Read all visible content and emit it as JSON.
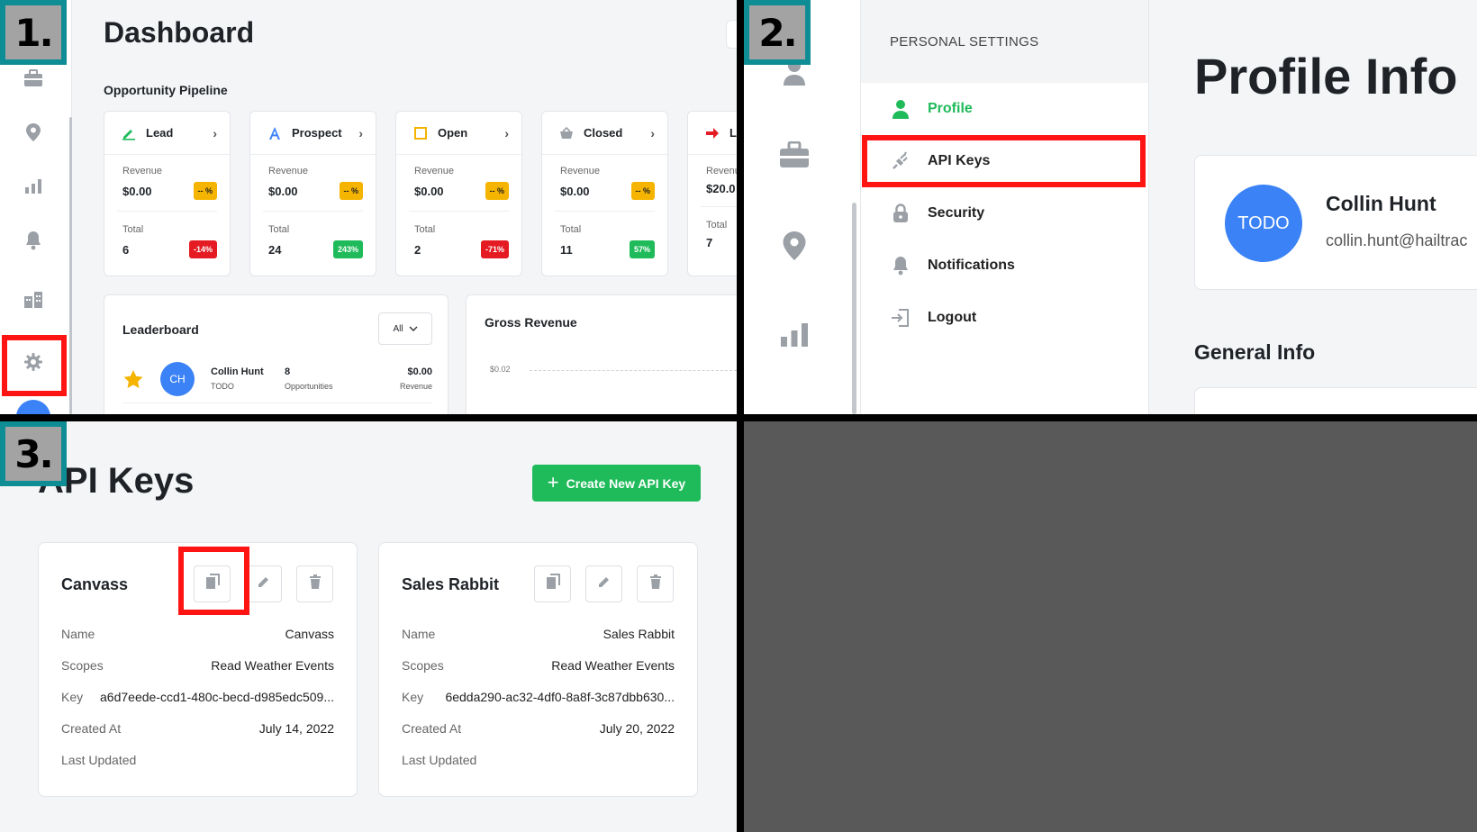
{
  "steps": [
    "1.",
    "2.",
    "3."
  ],
  "colors": {
    "accent_green": "#1fbb5a",
    "avatar_blue": "#3b82f6",
    "highlight_red": "#ff1414",
    "step_teal": "#0e8e94"
  },
  "dashboard": {
    "title": "Dashboard",
    "sidebar_icons": [
      "briefcase-icon",
      "map-pin-icon",
      "bar-chart-icon",
      "bell-icon",
      "buildings-icon",
      "gear-icon"
    ],
    "pipeline_title": "Opportunity Pipeline",
    "stages": [
      {
        "name": "Lead",
        "icon": "pencil-icon",
        "revenue_label": "Revenue",
        "revenue": "$0.00",
        "revenue_badge": "-- %",
        "total_label": "Total",
        "total": "6",
        "total_badge": "-14%",
        "total_badge_color": "red"
      },
      {
        "name": "Prospect",
        "icon": "letter-a-icon",
        "revenue_label": "Revenue",
        "revenue": "$0.00",
        "revenue_badge": "-- %",
        "total_label": "Total",
        "total": "24",
        "total_badge": "243%",
        "total_badge_color": "green"
      },
      {
        "name": "Open",
        "icon": "square-icon",
        "revenue_label": "Revenue",
        "revenue": "$0.00",
        "revenue_badge": "-- %",
        "total_label": "Total",
        "total": "2",
        "total_badge": "-71%",
        "total_badge_color": "red"
      },
      {
        "name": "Closed",
        "icon": "basket-icon",
        "revenue_label": "Revenue",
        "revenue": "$0.00",
        "revenue_badge": "-- %",
        "total_label": "Total",
        "total": "11",
        "total_badge": "57%",
        "total_badge_color": "green"
      },
      {
        "name": "L",
        "icon": "arrow-right-icon",
        "revenue_label": "Revenu",
        "revenue": "$20.0",
        "revenue_badge": "",
        "total_label": "Total",
        "total": "7",
        "total_badge": "",
        "total_badge_color": ""
      }
    ],
    "leaderboard": {
      "title": "Leaderboard",
      "filter": "All",
      "row": {
        "initials": "CH",
        "name": "Collin Hunt",
        "sub": "TODO",
        "count": "8",
        "count_label": "Opportunities",
        "revenue": "$0.00",
        "revenue_label": "Revenue"
      }
    },
    "gross_revenue": {
      "title": "Gross Revenue",
      "tick": "$0.02"
    }
  },
  "settings": {
    "sidebar_icons": [
      "person-icon",
      "briefcase-icon",
      "map-pin-icon",
      "bar-chart-icon"
    ],
    "heading": "PERSONAL SETTINGS",
    "menu": [
      {
        "label": "Profile",
        "icon": "person-icon",
        "active": true
      },
      {
        "label": "API Keys",
        "icon": "plug-icon",
        "active": false
      },
      {
        "label": "Security",
        "icon": "lock-icon",
        "active": false
      },
      {
        "label": "Notifications",
        "icon": "bell-icon",
        "active": false
      },
      {
        "label": "Logout",
        "icon": "logout-icon",
        "active": false
      }
    ],
    "profile_title": "Profile Info",
    "avatar_text": "TODO",
    "name": "Collin Hunt",
    "email": "collin.hunt@hailtrac",
    "general_title": "General Info"
  },
  "api_keys": {
    "title": "API Keys",
    "create_label": "Create New API Key",
    "keys": [
      {
        "title": "Canvass",
        "name_label": "Name",
        "name": "Canvass",
        "scopes_label": "Scopes",
        "scopes": "Read Weather Events",
        "key_label": "Key",
        "key": "a6d7eede-ccd1-480c-becd-d985edc509...",
        "created_label": "Created At",
        "created": "July 14, 2022",
        "updated_label": "Last Updated",
        "updated": ""
      },
      {
        "title": "Sales Rabbit",
        "name_label": "Name",
        "name": "Sales Rabbit",
        "scopes_label": "Scopes",
        "scopes": "Read Weather Events",
        "key_label": "Key",
        "key": "6edda290-ac32-4df0-8a8f-3c87dbb630...",
        "created_label": "Created At",
        "created": "July 20, 2022",
        "updated_label": "Last Updated",
        "updated": ""
      }
    ]
  }
}
